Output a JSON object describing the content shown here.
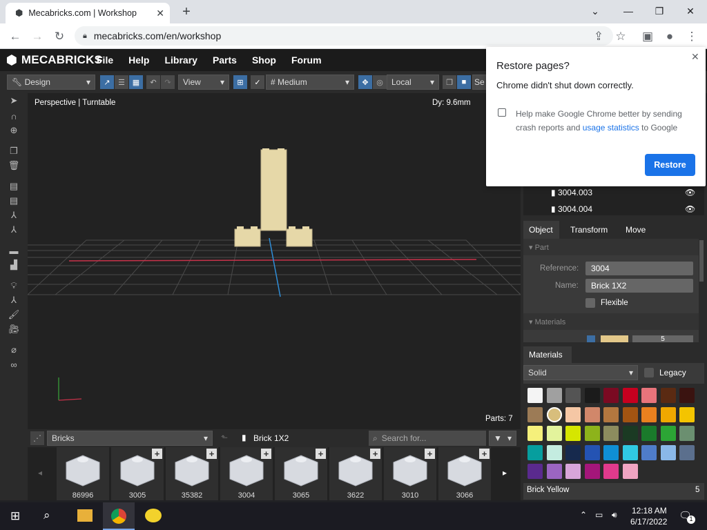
{
  "browser": {
    "tab_title": "Mecabricks.com | Workshop",
    "url": "mecabricks.com/en/workshop"
  },
  "restore": {
    "title": "Restore pages?",
    "message": "Chrome didn't shut down correctly.",
    "checkbox_text_a": "Help make Google Chrome better by sending",
    "checkbox_text_b": "crash reports and",
    "checkbox_link": "usage statistics",
    "checkbox_text_c": "to Google",
    "button": "Restore"
  },
  "app": {
    "brand": "MECABRICKS",
    "menu": [
      "File",
      "Help",
      "Library",
      "Parts",
      "Shop",
      "Forum"
    ],
    "mode": "Design",
    "view": "View",
    "quality": "Medium",
    "space": "Local",
    "settings_cut": "Se"
  },
  "viewport": {
    "camera": "Perspective | Turntable",
    "dy": "Dy: 9.6mm",
    "parts": "Parts: 7"
  },
  "outliner": {
    "items": [
      "3004.003",
      "3004.004"
    ]
  },
  "properties": {
    "tabs": [
      "Object",
      "Transform",
      "Move"
    ],
    "part_section": "Part",
    "reference_label": "Reference:",
    "reference": "3004",
    "name_label": "Name:",
    "name": "Brick 1X2",
    "flexible": "Flexible",
    "materials_section": "Materials",
    "mat_value": "5"
  },
  "materials": {
    "title": "Materials",
    "type": "Solid",
    "legacy": "Legacy",
    "selected": "Brick Yellow",
    "selected_id": "5",
    "colors": [
      "#f4f4f4",
      "#a0a0a0",
      "#545454",
      "#1b1b1b",
      "#7a0a22",
      "#c7001f",
      "#e8747b",
      "#5a2a12",
      "#3a1310",
      "#9c7b56",
      "#d8be7c",
      "#f5c7a5",
      "#d1876a",
      "#b3773f",
      "#a35412",
      "#e9801f",
      "#f0a800",
      "#f4c400",
      "#f5f07b",
      "#e3f39c",
      "#d6e600",
      "#8db31b",
      "#8c8c5e",
      "#1b3a23",
      "#1a7a2b",
      "#2ca535",
      "#6b8f70",
      "#069e9e",
      "#c4ece0",
      "#16294d",
      "#2453b3",
      "#0f8fd5",
      "#30c8e3",
      "#4f7cc9",
      "#8ab8e8",
      "#5b6f8d",
      "#5a2a8e",
      "#9b65c2",
      "#d8a5d9",
      "#a4167a",
      "#e03a8c",
      "#f0a4c2"
    ]
  },
  "bottom": {
    "category": "Bricks",
    "current": "Brick 1X2",
    "search_placeholder": "Search for...",
    "parts": [
      "86996",
      "3005",
      "35382",
      "3004",
      "3065",
      "3622",
      "3010",
      "3066"
    ]
  },
  "taskbar": {
    "time": "12:18 AM",
    "date": "6/17/2022",
    "notif": "1"
  }
}
